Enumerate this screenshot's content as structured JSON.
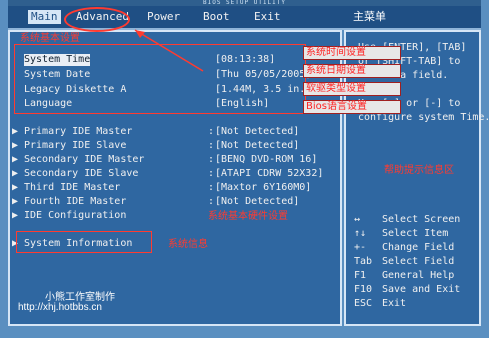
{
  "bios_title": "BIOS SETUP UTILITY",
  "menubar": {
    "items": [
      {
        "label": "Main",
        "name": "menu-main"
      },
      {
        "label": "Advanced",
        "name": "menu-advanced"
      },
      {
        "label": "Power",
        "name": "menu-power"
      },
      {
        "label": "Boot",
        "name": "menu-boot"
      },
      {
        "label": "Exit",
        "name": "menu-exit"
      }
    ],
    "right_title": "主菜单"
  },
  "main": {
    "section_caption": "系统基本设置",
    "rows": [
      {
        "label": "System Time",
        "sep": "",
        "value": "[08:13:38]"
      },
      {
        "label": "System Date",
        "sep": "",
        "value": "[Thu 05/05/2005]"
      },
      {
        "label": "Legacy Diskette A",
        "sep": "",
        "value": "[1.44M, 3.5 in.]"
      },
      {
        "label": "Language",
        "sep": "",
        "value": "[English]"
      }
    ],
    "ide_rows": [
      {
        "label": "Primary IDE Master",
        "sep": ":",
        "value": "[Not Detected]"
      },
      {
        "label": "Primary IDE Slave",
        "sep": ":",
        "value": "[Not Detected]"
      },
      {
        "label": "Secondary IDE Master",
        "sep": ":",
        "value": "[BENQ    DVD-ROM 16]"
      },
      {
        "label": "Secondary IDE Slave",
        "sep": ":",
        "value": "[ATAPI   CDRW 52X32]"
      },
      {
        "label": "Third IDE Master",
        "sep": ":",
        "value": "[Maxtor 6Y160M0]"
      },
      {
        "label": "Fourth IDE Master",
        "sep": ":",
        "value": "[Not Detected]"
      },
      {
        "label": "IDE Configuration",
        "sep": "",
        "value": ""
      }
    ],
    "sysinfo_label": "System Information",
    "hw_caption": "系统基本硬件设置",
    "sysinfo_caption": "系统信息"
  },
  "overlays": {
    "time": "系统时间设置",
    "date": "系统日期设置",
    "floppy": "软驱类型设置",
    "language": "Bios语言设置"
  },
  "help": {
    "lines": [
      "Use [ENTER], [TAB]",
      "or [SHIFT-TAB] to",
      "select a field.",
      "",
      "Use [+] or [-] to",
      "configure system Time."
    ],
    "hint_caption": "帮助提示信息区",
    "keys": [
      {
        "key": "↔",
        "desc": "Select Screen"
      },
      {
        "key": "↑↓",
        "desc": "Select Item"
      },
      {
        "key": "+-",
        "desc": "Change Field"
      },
      {
        "key": "Tab",
        "desc": "Select Field"
      },
      {
        "key": "F1",
        "desc": "General Help"
      },
      {
        "key": "F10",
        "desc": "Save and Exit"
      },
      {
        "key": "ESC",
        "desc": "Exit"
      }
    ]
  },
  "watermark": {
    "studio": "小熊工作室制作",
    "url": "http://xhj.hotbbs.cn"
  },
  "colors": {
    "bios_bg": "#2f67a1",
    "menubar_bg": "#1f4f84",
    "annotation_red": "#ff3b30",
    "annotation_orange": "#ff9b2f"
  }
}
